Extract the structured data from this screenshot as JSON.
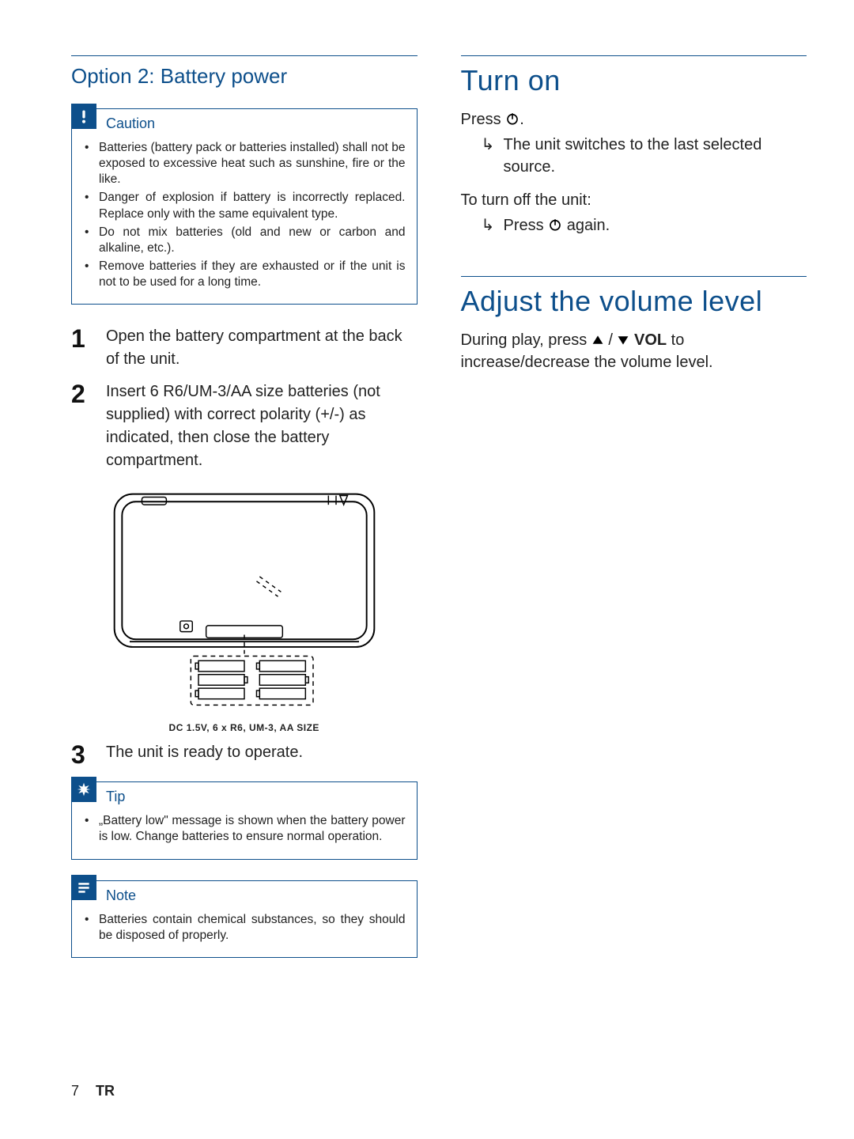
{
  "left": {
    "heading": "Option 2: Battery power",
    "caution": {
      "title": "Caution",
      "items": [
        "Batteries (battery pack or batteries installed) shall not be exposed to excessive heat such as sunshine, fire or the like.",
        "Danger of explosion if battery is incorrectly replaced. Replace only with the same equivalent type.",
        "Do not mix batteries (old and new or carbon and alkaline, etc.).",
        "Remove batteries if they are exhausted or if the unit is not to be used for a long time."
      ]
    },
    "steps": {
      "s1": "Open the battery compartment at the back of the unit.",
      "s2": "Insert 6 R6/UM-3/AA size batteries (not supplied) with correct polarity  (+/-) as indicated, then close the battery compartment.",
      "s3": "The unit is ready to operate."
    },
    "battery_label": "DC 1.5V, 6 x R6, UM-3, AA SIZE",
    "tip": {
      "title": "Tip",
      "text": "„Battery low\" message is shown when the battery power is low. Change batteries to ensure normal operation."
    },
    "note": {
      "title": "Note",
      "text": "Batteries contain chemical substances, so they should be disposed of properly."
    }
  },
  "right": {
    "turnon": {
      "heading": "Turn on",
      "press_prefix": "Press ",
      "press_suffix": ".",
      "result": "The unit switches to the last selected source.",
      "off_intro": "To turn off the unit:",
      "off_step_prefix": "Press ",
      "off_step_suffix": " again."
    },
    "volume": {
      "heading": "Adjust the volume level",
      "text_prefix": "During play, press ",
      "text_mid": " / ",
      "vol_label": "VOL",
      "text_suffix": " to increase/decrease the volume level."
    }
  },
  "footer": {
    "page": "7",
    "lang": "TR"
  }
}
